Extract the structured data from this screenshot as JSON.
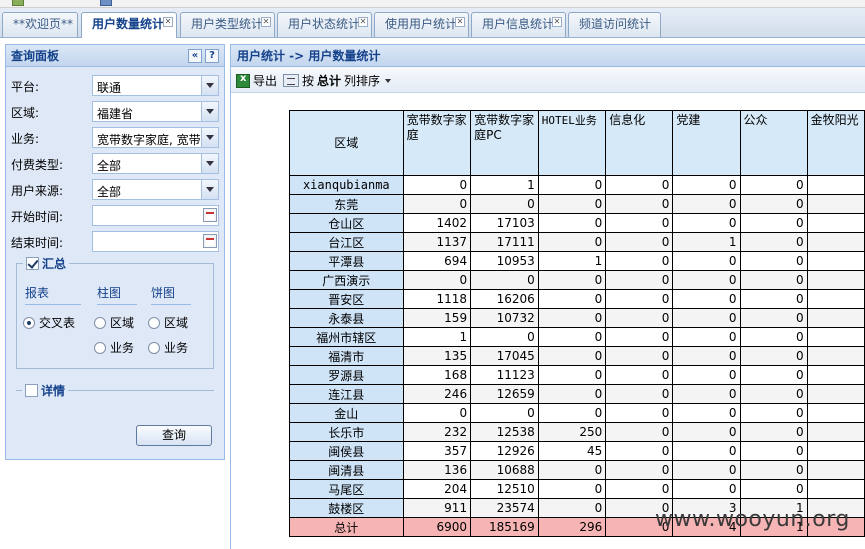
{
  "tabs": [
    {
      "label": "**欢迎页**",
      "active": false
    },
    {
      "label": "用户数量统计",
      "active": true
    },
    {
      "label": "用户类型统计",
      "active": false
    },
    {
      "label": "用户状态统计",
      "active": false
    },
    {
      "label": "使用用户统计",
      "active": false
    },
    {
      "label": "用户信息统计",
      "active": false
    },
    {
      "label": "频道访问统计",
      "active": false
    }
  ],
  "query_panel": {
    "title": "查询面板",
    "collapse_icon": "«",
    "help_icon": "?",
    "fields": [
      {
        "label": "平台:",
        "value": "联通"
      },
      {
        "label": "区域:",
        "value": "福建省"
      },
      {
        "label": "业务:",
        "value": "宽带数字家庭, 宽带"
      },
      {
        "label": "付费类型:",
        "value": "全部"
      },
      {
        "label": "用户来源:",
        "value": "全部"
      }
    ],
    "start_label": "开始时间:",
    "end_label": "结束时间:",
    "summary": {
      "legend": "汇总",
      "groups": [
        "报表",
        "柱图",
        "饼图"
      ],
      "opt_crosstab": "交叉表",
      "opt_bar_area": "区域",
      "opt_bar_biz": "业务",
      "opt_pie_area": "区域",
      "opt_pie_biz": "业务"
    },
    "detail_legend": "详情",
    "query_button": "查询"
  },
  "content": {
    "title": "用户统计 -> 用户数量统计",
    "export_label": "导出",
    "sort_prefix": "按",
    "sort_bold": "总计",
    "sort_suffix": "列排序"
  },
  "table": {
    "area_header": "区域",
    "headers": [
      "宽带数字家庭",
      "宽带数字家庭PC",
      "HOTEL业务",
      "信息化",
      "党建",
      "公众",
      "金牧阳光"
    ],
    "rows": [
      {
        "name": "xianqubianma",
        "values": [
          "0",
          "1",
          "0",
          "0",
          "0",
          "0",
          ""
        ]
      },
      {
        "name": "东莞",
        "values": [
          "0",
          "0",
          "0",
          "0",
          "0",
          "0",
          ""
        ]
      },
      {
        "name": "仓山区",
        "values": [
          "1402",
          "17103",
          "0",
          "0",
          "0",
          "0",
          ""
        ]
      },
      {
        "name": "台江区",
        "values": [
          "1137",
          "17111",
          "0",
          "0",
          "1",
          "0",
          ""
        ]
      },
      {
        "name": "平潭县",
        "values": [
          "694",
          "10953",
          "1",
          "0",
          "0",
          "0",
          ""
        ]
      },
      {
        "name": "广西演示",
        "values": [
          "0",
          "0",
          "0",
          "0",
          "0",
          "0",
          ""
        ]
      },
      {
        "name": "晋安区",
        "values": [
          "1118",
          "16206",
          "0",
          "0",
          "0",
          "0",
          ""
        ]
      },
      {
        "name": "永泰县",
        "values": [
          "159",
          "10732",
          "0",
          "0",
          "0",
          "0",
          ""
        ]
      },
      {
        "name": "福州市辖区",
        "values": [
          "1",
          "0",
          "0",
          "0",
          "0",
          "0",
          ""
        ]
      },
      {
        "name": "福清市",
        "values": [
          "135",
          "17045",
          "0",
          "0",
          "0",
          "0",
          ""
        ]
      },
      {
        "name": "罗源县",
        "values": [
          "168",
          "11123",
          "0",
          "0",
          "0",
          "0",
          ""
        ]
      },
      {
        "name": "连江县",
        "values": [
          "246",
          "12659",
          "0",
          "0",
          "0",
          "0",
          ""
        ]
      },
      {
        "name": "金山",
        "values": [
          "0",
          "0",
          "0",
          "0",
          "0",
          "0",
          ""
        ]
      },
      {
        "name": "长乐市",
        "values": [
          "232",
          "12538",
          "250",
          "0",
          "0",
          "0",
          ""
        ]
      },
      {
        "name": "闽侯县",
        "values": [
          "357",
          "12926",
          "45",
          "0",
          "0",
          "0",
          ""
        ]
      },
      {
        "name": "闽清县",
        "values": [
          "136",
          "10688",
          "0",
          "0",
          "0",
          "0",
          ""
        ]
      },
      {
        "name": "马尾区",
        "values": [
          "204",
          "12510",
          "0",
          "0",
          "0",
          "0",
          ""
        ]
      },
      {
        "name": "鼓楼区",
        "values": [
          "911",
          "23574",
          "0",
          "0",
          "3",
          "1",
          ""
        ]
      }
    ],
    "total": {
      "name": "总计",
      "values": [
        "6900",
        "185169",
        "296",
        "0",
        "4",
        "1",
        ""
      ]
    }
  },
  "watermark": "www.wooyun.org"
}
